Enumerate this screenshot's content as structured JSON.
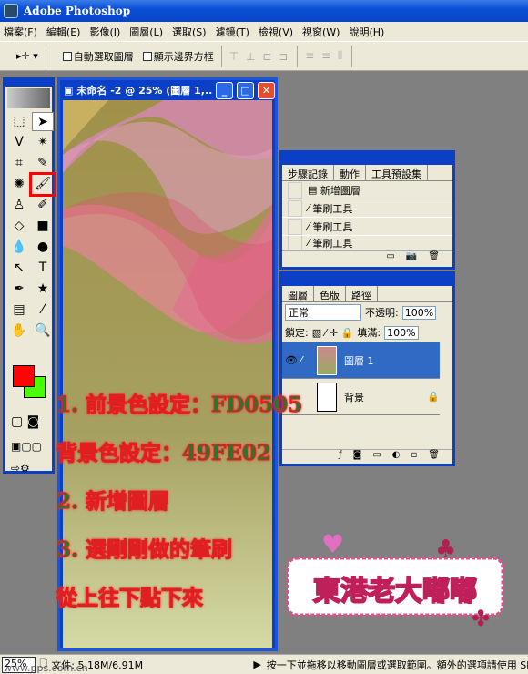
{
  "app": {
    "title": "Adobe Photoshop"
  },
  "menu": [
    "檔案(F)",
    "編輯(E)",
    "影像(I)",
    "圖層(L)",
    "選取(S)",
    "濾鏡(T)",
    "檢視(V)",
    "視窗(W)",
    "說明(H)"
  ],
  "options": {
    "auto_select": "自動選取圖層",
    "show_bounds": "顯示邊界方框",
    "align_icons": "⊤ ⊥ ⊏ ⊐",
    "dist_icons": "≡ ≡ ⫴"
  },
  "document": {
    "title": "未命名 -2 @ 25% (圖層 1,..."
  },
  "colors": {
    "foreground": "#FD0505",
    "background": "#49FE02"
  },
  "history": {
    "tabs": [
      "步驟記錄",
      "動作",
      "工具預設集"
    ],
    "items": [
      "新增圖層",
      "筆刷工具",
      "筆刷工具",
      "筆刷工具"
    ]
  },
  "layers": {
    "tabs": [
      "圖層",
      "色版",
      "路徑"
    ],
    "blend_mode": "正常",
    "opacity_label": "不透明:",
    "opacity": "100%",
    "lock_label": "鎖定:",
    "fill_label": "填滿:",
    "fill": "100%",
    "items": [
      {
        "name": "圖層 1",
        "selected": true
      },
      {
        "name": "背景",
        "locked": true
      }
    ]
  },
  "annotations": [
    "1. 前景色設定：FD0505",
    "背景色設定：49FE02",
    "2. 新增圖層",
    "3. 選剛剛做的筆刷",
    "從上往下點下來"
  ],
  "logo_text": "東港老大嘟嘟",
  "status": {
    "zoom": "25%",
    "doc": "文件: 5.18M/6.91M",
    "watermark": "www.pps.com.cn",
    "hint": "按一下並拖移以移動圖層或選取範圍。額外的選項請使用 Sh"
  }
}
